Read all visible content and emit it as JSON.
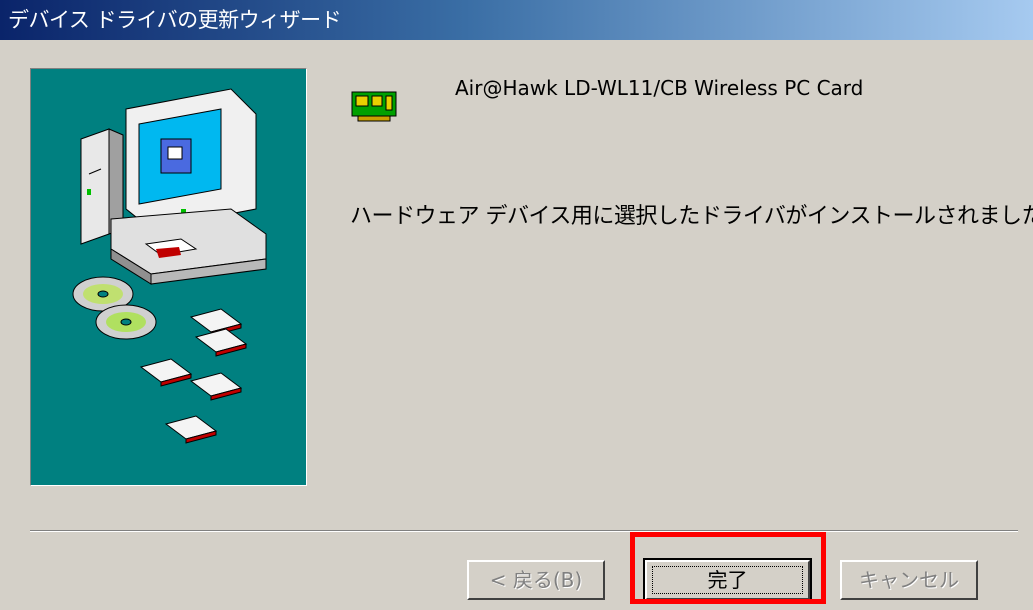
{
  "window": {
    "title": "デバイス ドライバの更新ウィザード"
  },
  "device": {
    "name": "Air@Hawk LD-WL11/CB Wireless PC Card",
    "icon": "pc-card-icon"
  },
  "main": {
    "message": "ハードウェア デバイス用に選択したドライバがインストールされました。"
  },
  "buttons": {
    "back_label": "< 戻る(B)",
    "finish_label": "完了",
    "cancel_label": "キャンセル"
  },
  "colors": {
    "title_bar_start": "#0a246a",
    "title_bar_end": "#a6caf0",
    "dialog_bg": "#d4d0c8",
    "art_bg": "#008080",
    "highlight": "#ff0000"
  }
}
